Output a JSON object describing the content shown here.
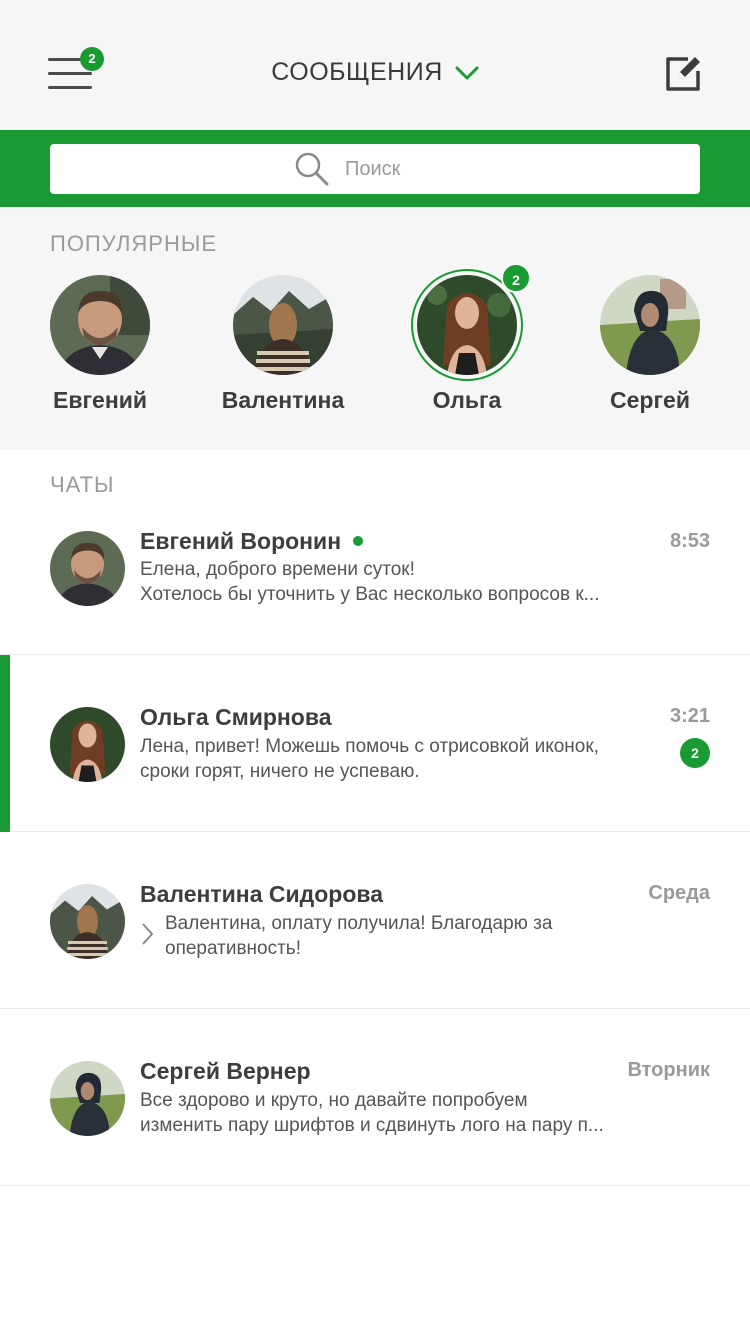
{
  "header": {
    "title": "СООБЩЕНИЯ",
    "menu_badge": "2",
    "accent": "#1a9a33"
  },
  "search": {
    "placeholder": "Поиск"
  },
  "popular": {
    "label": "ПОПУЛЯРНЫЕ",
    "people": [
      {
        "name": "Евгений"
      },
      {
        "name": "Валентина"
      },
      {
        "name": "Ольга",
        "badge": "2"
      },
      {
        "name": "Сергей"
      }
    ]
  },
  "chats": {
    "label": "ЧАТЫ",
    "items": [
      {
        "name": "Евгений Воронин",
        "online": true,
        "time": "8:53",
        "line1": "Елена, доброго времени суток!",
        "line2": "Хотелось бы уточнить у Вас несколько вопросов к..."
      },
      {
        "name": "Ольга Смирнова",
        "time": "3:21",
        "badge": "2",
        "line1": "Лена, привет! Можешь помочь с отрисовкой иконок,",
        "line2": "сроки горят, ничего не успеваю."
      },
      {
        "name": "Валентина Сидорова",
        "time": "Среда",
        "line1": "Валентина, оплату получила! Благодарю за",
        "line2": "оперативность!"
      },
      {
        "name": "Сергей Вернер",
        "time": "Вторник",
        "line1": "Все здорово и круто, но давайте попробуем",
        "line2": "изменить пару шрифтов и сдвинуть лого на пару п..."
      }
    ]
  }
}
